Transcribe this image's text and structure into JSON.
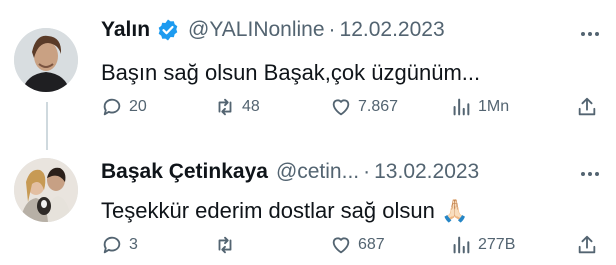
{
  "tweets": [
    {
      "name": "Yalın",
      "verified": true,
      "handle": "@YALINonline",
      "separator": "·",
      "date": "12.02.2023",
      "text": "Başın sağ olsun Başak,çok üzgünüm...",
      "stats": {
        "replies": "20",
        "retweets": "48",
        "likes": "7.867",
        "views": "1Mn"
      }
    },
    {
      "name": "Başak Çetinkaya",
      "verified": false,
      "handle": "@cetin...",
      "separator": "·",
      "date": "13.02.2023",
      "text": "Teşekkür ederim dostlar sağ olsun",
      "emoji": "🙏🏻",
      "stats": {
        "replies": "3",
        "retweets": "",
        "likes": "687",
        "views": "277B"
      }
    }
  ],
  "colors": {
    "text": "#0f1419",
    "secondary": "#536471",
    "verified": "#1d9bf0",
    "thread_line": "#cfd9de"
  },
  "icons": [
    "more-icon",
    "verified-icon",
    "reply-icon",
    "retweet-icon",
    "like-icon",
    "views-icon",
    "share-icon"
  ]
}
